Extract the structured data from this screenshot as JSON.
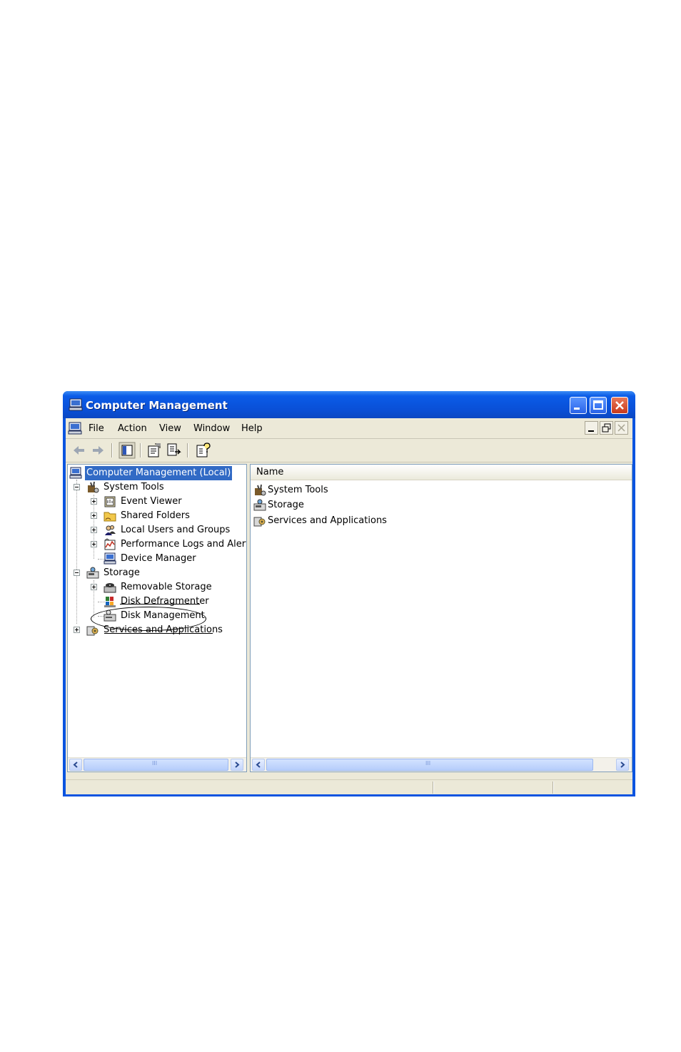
{
  "window": {
    "title": "Computer Management",
    "accent_color": "#0a54e0",
    "icon": "computer-icon",
    "controls": [
      "minimize-icon",
      "maximize-icon",
      "close-icon"
    ]
  },
  "menu": {
    "items": [
      {
        "label": "File"
      },
      {
        "label": "Action"
      },
      {
        "label": "View"
      },
      {
        "label": "Window"
      },
      {
        "label": "Help"
      }
    ]
  },
  "toolbar": {
    "buttons": [
      "back-icon",
      "forward-icon",
      "show-hide-tree-icon",
      "properties-icon",
      "export-list-icon",
      "help-icon"
    ]
  },
  "tree": {
    "root": "Computer Management (Local)",
    "system_tools": "System Tools",
    "event_viewer": "Event Viewer",
    "shared_folders": "Shared Folders",
    "local_users": "Local Users and Groups",
    "perf_logs": "Performance Logs and Alerts",
    "device_manager": "Device Manager",
    "storage": "Storage",
    "removable_storage": "Removable Storage",
    "disk_defragmenter": "Disk Defragmenter",
    "disk_management": "Disk Management",
    "services_apps": "Services and Applications"
  },
  "list": {
    "column_name": "Name",
    "items": [
      {
        "label": "System Tools"
      },
      {
        "label": "Storage"
      },
      {
        "label": "Services and Applications"
      }
    ]
  },
  "scroll_thumb_glyph": "III"
}
